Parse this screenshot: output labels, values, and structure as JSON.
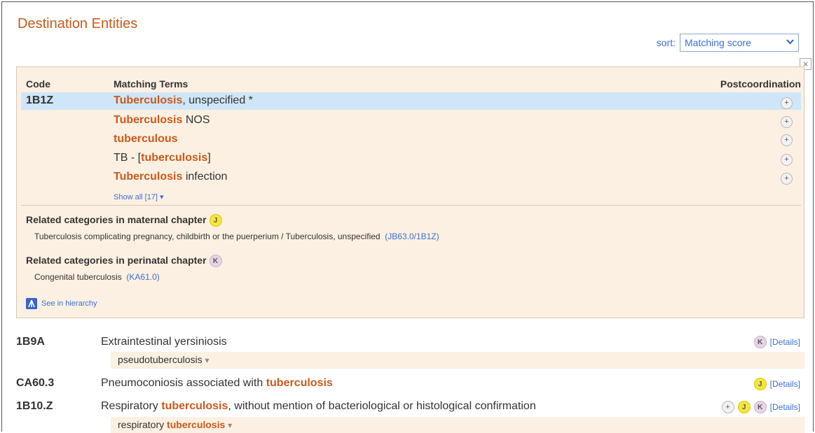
{
  "header": {
    "title": "Destination Entities",
    "sort_label": "sort:",
    "sort_value": "Matching score",
    "close_symbol": "×"
  },
  "panel": {
    "col_code": "Code",
    "col_terms": "Matching Terms",
    "col_postcoord": "Postcoordination",
    "code": "1B1Z",
    "terms": [
      {
        "hl": "Tuberculosis",
        "rest": ", unspecified *"
      },
      {
        "hl": "Tuberculosis",
        "rest": " NOS"
      },
      {
        "hl": "tuberculous",
        "rest": ""
      },
      {
        "pre": "TB - [",
        "hl": "tuberculosis",
        "rest": "]"
      },
      {
        "hl": "Tuberculosis",
        "rest": " infection"
      }
    ],
    "show_all": "Show all [17]",
    "show_all_caret": "▾",
    "maternal_title": "Related categories in maternal chapter",
    "maternal_badge": "J",
    "maternal_text": "Tuberculosis complicating pregnancy, childbirth or the puerperium / Tuberculosis, unspecified",
    "maternal_link": "(JB63.0/1B1Z)",
    "perinatal_title": "Related categories in perinatal chapter",
    "perinatal_badge": "K",
    "perinatal_text": "Congenital tuberculosis",
    "perinatal_link": "(KA61.0)",
    "see_hierarchy": "See in hierarchy",
    "plus_symbol": "+"
  },
  "results": [
    {
      "code": "1B9A",
      "title_pre": "Extraintestinal yersiniosis",
      "title_hl": "",
      "title_post": "",
      "sub_pre": "pseudotuberculosis",
      "sub_hl": "",
      "badges": [
        "K"
      ],
      "details": "[Details]"
    },
    {
      "code": "CA60.3",
      "title_pre": "Pneumoconiosis associated with ",
      "title_hl": "tuberculosis",
      "title_post": "",
      "badges": [
        "J"
      ],
      "details": "[Details]"
    },
    {
      "code": "1B10.Z",
      "title_pre": "Respiratory ",
      "title_hl": "tuberculosis",
      "title_post": ", without mention of bacteriological or histological confirmation",
      "sub_pre": "respiratory ",
      "sub_hl": "tuberculosis",
      "badges": [
        "+",
        "J",
        "K"
      ],
      "details": "[Details]"
    }
  ],
  "sub_caret": "▾",
  "colors": {
    "accent": "#c95a1b",
    "link": "#3b6fd6",
    "panel_bg": "#fcf0e2",
    "selected_row": "#cfe6f8",
    "badge_j": "#f5e63c",
    "badge_k": "#e6d5e6"
  }
}
